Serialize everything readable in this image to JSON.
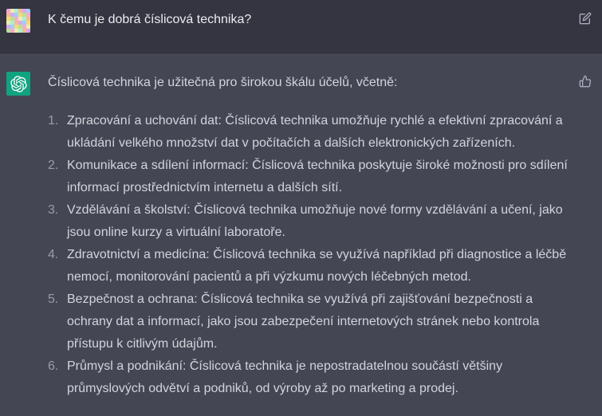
{
  "user": {
    "question": "K čemu je dobrá číslicová technika?"
  },
  "assistant": {
    "intro": "Číslicová technika je užitečná pro širokou škálu účelů, včetně:",
    "items": [
      {
        "num": "1.",
        "text": "Zpracování a uchování dat: Číslicová technika umožňuje rychlé a efektivní zpracování a ukládání velkého množství dat v počítačích a dalších elektronických zařízeních."
      },
      {
        "num": "2.",
        "text": "Komunikace a sdílení informací: Číslicová technika poskytuje široké možnosti pro sdílení informací prostřednictvím internetu a dalších sítí."
      },
      {
        "num": "3.",
        "text": "Vzdělávání a školství: Číslicová technika umožňuje nové formy vzdělávání a učení, jako jsou online kurzy a virtuální laboratoře."
      },
      {
        "num": "4.",
        "text": "Zdravotnictví a medicína: Číslicová technika se využívá například při diagnostice a léčbě nemocí, monitorování pacientů a při výzkumu nových léčebných metod."
      },
      {
        "num": "5.",
        "text": "Bezpečnost a ochrana: Číslicová technika se využívá při zajišťování bezpečnosti a ochrany dat a informací, jako jsou zabezpečení internetových stránek nebo kontrola přístupu k citlivým údajům."
      },
      {
        "num": "6.",
        "text": "Průmysl a podnikání: Číslicová technika je nepostradatelnou součástí většiny průmyslových odvětví a podniků, od výroby až po marketing a prodej."
      }
    ]
  },
  "icons": {
    "user_avatar": "pixel-identicon",
    "assistant_avatar": "openai-logo-icon",
    "edit": "edit-icon",
    "thumbs_up": "thumbs-up-icon"
  },
  "colors": {
    "user_bg": "#343541",
    "assistant_bg": "#444654",
    "assistant_avatar_bg": "#10a37f",
    "text": "#d1d5db"
  }
}
